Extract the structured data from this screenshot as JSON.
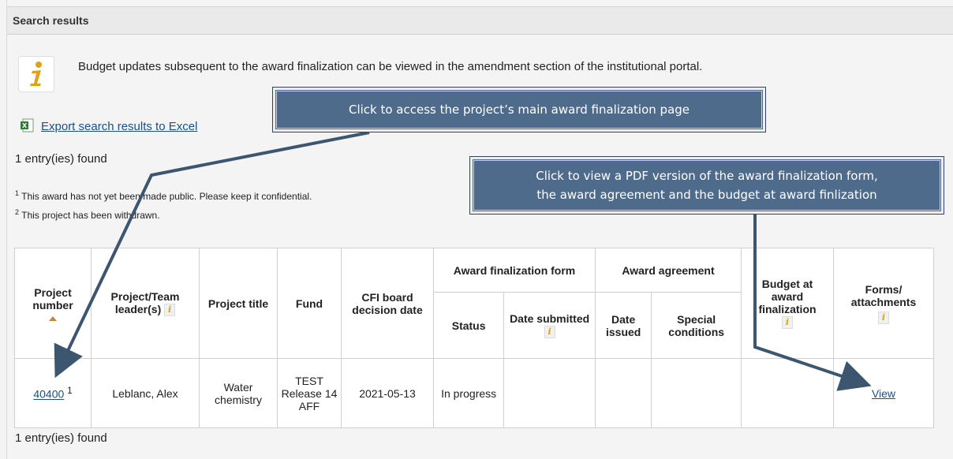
{
  "header": {
    "title": "Search results"
  },
  "info": {
    "message": "Budget updates subsequent to the award finalization can be viewed in the amendment section of the institutional portal."
  },
  "export": {
    "label": "Export search results to Excel"
  },
  "results": {
    "count_top": "1 entry(ies) found",
    "count_bottom": "1 entry(ies) found"
  },
  "notes": [
    {
      "num": "1",
      "text": "This award has not yet been made public. Please keep it confidential."
    },
    {
      "num": "2",
      "text": "This project has been withdrawn."
    }
  ],
  "table": {
    "headers": {
      "project_number": "Project number",
      "leader": "Project/Team leader(s)",
      "title": "Project title",
      "fund": "Fund",
      "board_date": "CFI board decision date",
      "award_form": "Award finalization form",
      "status": "Status",
      "date_submitted": "Date submitted",
      "agreement": "Award agreement",
      "date_issued": "Date issued",
      "special": "Special conditions",
      "budget": "Budget at award finalization",
      "forms": "Forms/ attachments"
    },
    "row": {
      "project_number": "40400",
      "note_ref": "1",
      "leader": "Leblanc, Alex",
      "title": "Water chemistry",
      "fund": "TEST Release 14 AFF",
      "board_date": "2021-05-13",
      "status": "In progress",
      "date_submitted": "",
      "date_issued": "",
      "special": "",
      "budget": "",
      "forms_link": "View"
    }
  },
  "callouts": {
    "top": "Click to access the project’s main award finalization page",
    "right_line1": "Click to view a PDF version of the award finalization form,",
    "right_line2": "the award agreement and the budget at award finlization"
  },
  "colors": {
    "callout_bg": "#4e6b8b",
    "link": "#1a4f8a",
    "arrow": "#3d5670"
  }
}
